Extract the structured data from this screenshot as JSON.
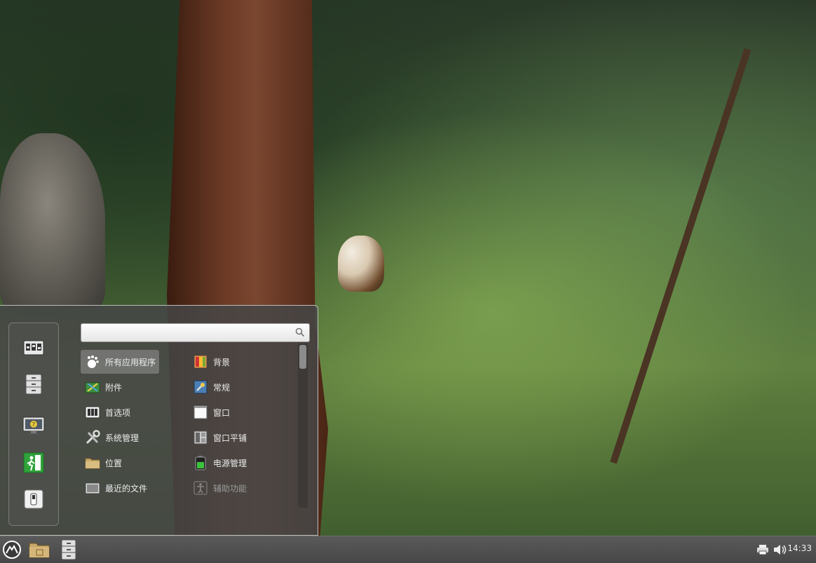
{
  "menu": {
    "search": {
      "value": "",
      "icon": "search-icon"
    },
    "favorites": [
      {
        "name": "system-settings",
        "icon": "control-panel-icon"
      },
      {
        "name": "file-manager",
        "icon": "file-cabinet-icon"
      },
      {
        "name": "lock-screen",
        "icon": "monitor-lock-icon"
      },
      {
        "name": "logout",
        "icon": "exit-door-icon"
      },
      {
        "name": "shutdown",
        "icon": "power-switch-icon"
      }
    ],
    "categories_left": [
      {
        "label": "所有应用程序",
        "icon": "gnome-foot-icon",
        "selected": true
      },
      {
        "label": "附件",
        "icon": "accessories-icon"
      },
      {
        "label": "首选项",
        "icon": "preferences-icon"
      },
      {
        "label": "系统管理",
        "icon": "tools-icon"
      },
      {
        "label": "位置",
        "icon": "folder-icon"
      },
      {
        "label": "最近的文件",
        "icon": "recent-files-icon"
      }
    ],
    "categories_right": [
      {
        "label": "背景",
        "icon": "background-icon"
      },
      {
        "label": "常规",
        "icon": "general-icon"
      },
      {
        "label": "窗口",
        "icon": "window-icon"
      },
      {
        "label": "窗口平铺",
        "icon": "tiling-icon"
      },
      {
        "label": "电源管理",
        "icon": "battery-icon"
      },
      {
        "label": "辅助功能",
        "icon": "accessibility-icon",
        "disabled": true
      }
    ]
  },
  "panel": {
    "menu_button_icon": "mint-logo-icon",
    "launchers": [
      "home-folder-icon",
      "file-cabinet-icon"
    ],
    "tray": [
      "printer-icon",
      "volume-icon"
    ],
    "clock": "14:33"
  }
}
